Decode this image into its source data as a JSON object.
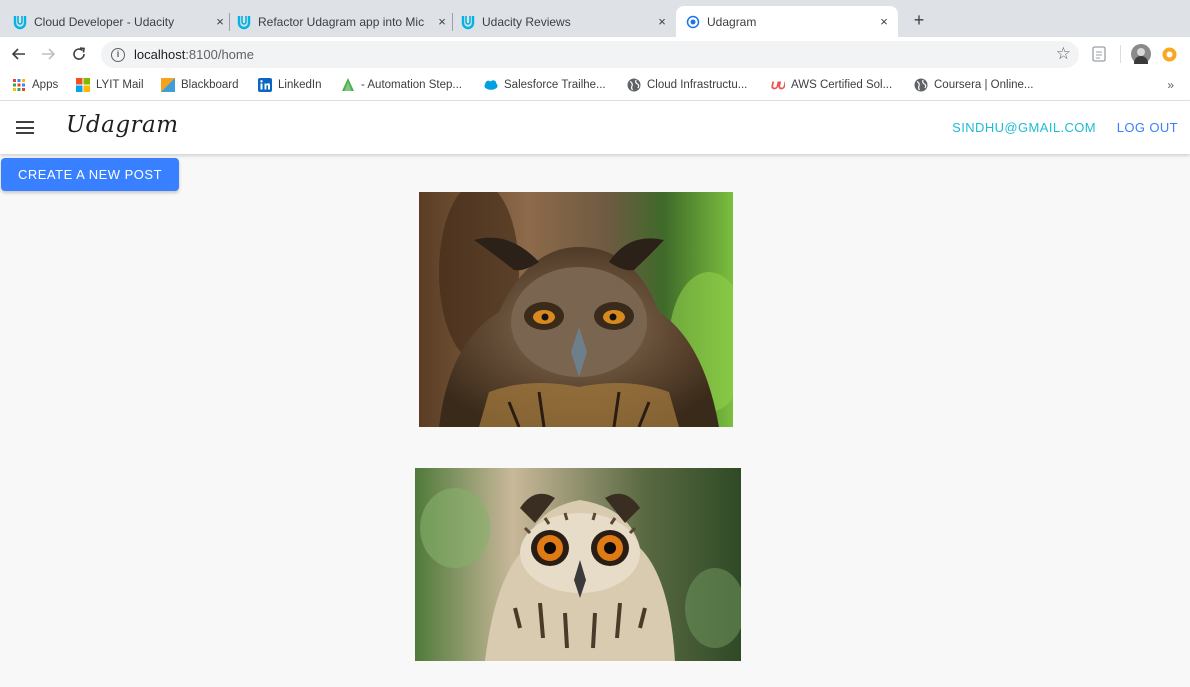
{
  "browser": {
    "tabs": [
      {
        "title": "Cloud Developer - Udacity",
        "icon": "udacity-icon",
        "active": false
      },
      {
        "title": "Refactor Udagram app into Mic",
        "icon": "udacity-icon",
        "active": false
      },
      {
        "title": "Udacity Reviews",
        "icon": "udacity-icon",
        "active": false
      },
      {
        "title": "Udagram",
        "icon": "chrome-loading-icon",
        "active": true
      }
    ],
    "close_glyph": "×",
    "newtab_glyph": "+",
    "url_host": "localhost",
    "url_path": ":8100/home",
    "bookmarks": [
      {
        "label": "Apps",
        "icon": "apps-grid-icon"
      },
      {
        "label": "LYIT Mail",
        "icon": "microsoft-icon"
      },
      {
        "label": "Blackboard",
        "icon": "blackboard-icon"
      },
      {
        "label": "LinkedIn",
        "icon": "linkedin-icon"
      },
      {
        "label": "- Automation Step...",
        "icon": "automation-icon"
      },
      {
        "label": "Salesforce Trailhe...",
        "icon": "salesforce-icon"
      },
      {
        "label": "Cloud Infrastructu...",
        "icon": "globe-icon"
      },
      {
        "label": "AWS Certified Sol...",
        "icon": "udemy-icon"
      },
      {
        "label": "Coursera | Online...",
        "icon": "globe-icon"
      }
    ],
    "bookmarks_more": "»"
  },
  "app": {
    "brand": "Udagram",
    "user_email": "SINDHU@GMAIL.COM",
    "logout_label": "LOG OUT",
    "create_post_label": "CREATE A NEW POST"
  },
  "feed": {
    "posts": [
      {
        "image": "owl-photo-1"
      },
      {
        "image": "owl-photo-2"
      }
    ]
  },
  "colors": {
    "primary": "#3880ff",
    "secondary": "#1fbcd3"
  }
}
